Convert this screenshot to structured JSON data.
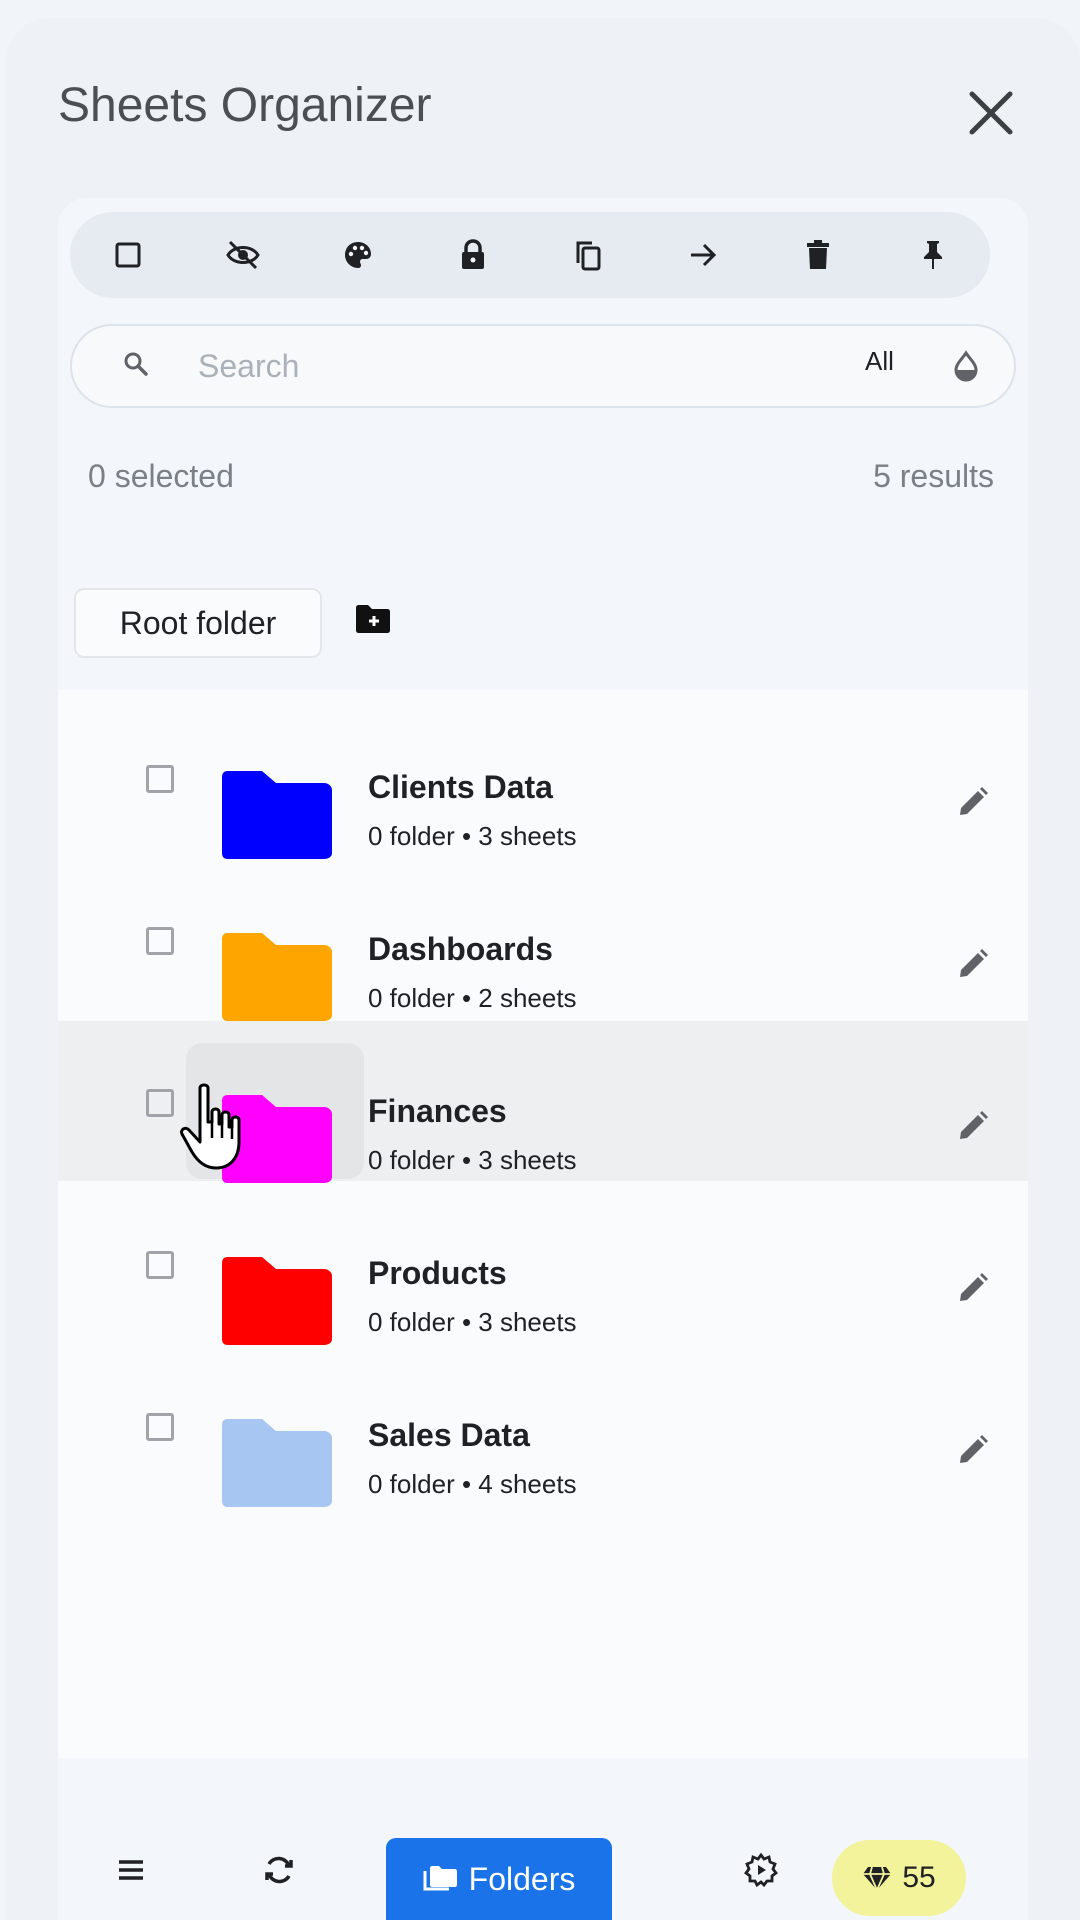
{
  "header": {
    "title": "Sheets Organizer",
    "close_icon": "close-icon"
  },
  "toolbar": {
    "tools": [
      {
        "icon": "checkbox-square-icon"
      },
      {
        "icon": "eye-off-icon"
      },
      {
        "icon": "palette-icon"
      },
      {
        "icon": "lock-icon"
      },
      {
        "icon": "copy-icon"
      },
      {
        "icon": "arrow-right-icon"
      },
      {
        "icon": "trash-icon"
      },
      {
        "icon": "pin-icon"
      }
    ]
  },
  "search": {
    "placeholder": "Search",
    "value": "",
    "filter_label": "All",
    "search_icon": "search-icon",
    "color_filter_icon": "color-drop-icon"
  },
  "status": {
    "selected": "0 selected",
    "results": "5 results"
  },
  "breadcrumb": {
    "root_label": "Root folder",
    "new_folder_icon": "create-new-folder-icon"
  },
  "folders": [
    {
      "name": "Clients Data",
      "meta": "0 folder • 3 sheets",
      "color": "#0000ff",
      "hovered": false
    },
    {
      "name": "Dashboards",
      "meta": "0 folder • 2 sheets",
      "color": "#ffa500",
      "hovered": false
    },
    {
      "name": "Finances",
      "meta": "0 folder • 3 sheets",
      "color": "#ff00ff",
      "hovered": true
    },
    {
      "name": "Products",
      "meta": "0 folder • 3 sheets",
      "color": "#ff0000",
      "hovered": false
    },
    {
      "name": "Sales Data",
      "meta": "0 folder • 4 sheets",
      "color": "#a7c7f2",
      "hovered": false
    }
  ],
  "bottom_nav": {
    "menu_icon": "menu-icon",
    "sync_icon": "sync-icon",
    "folders_label": "Folders",
    "folders_icon": "folders-icon",
    "settings_icon": "settings-icon",
    "credits_icon": "diamond-icon",
    "credits_value": "55"
  },
  "colors": {
    "accent": "#1a73e8",
    "credits_badge": "#f2f39a"
  }
}
